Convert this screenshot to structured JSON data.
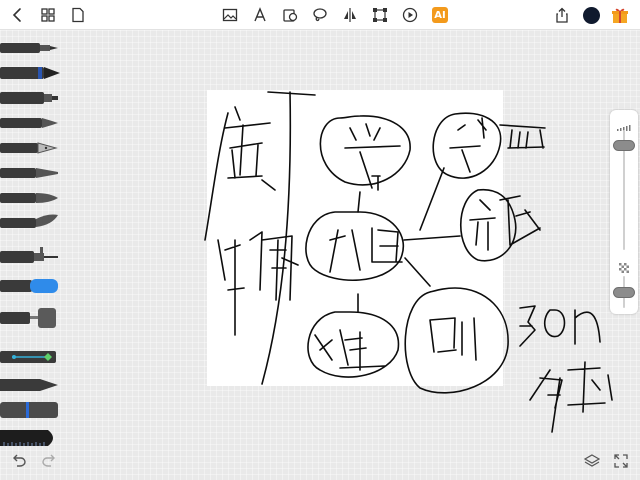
{
  "toolbar": {
    "ai_label": "AI",
    "left_icons": [
      "back-icon",
      "grid-icon",
      "document-icon"
    ],
    "center_icons": [
      "image-icon",
      "text-icon",
      "shape-icon",
      "lasso-icon",
      "flip-icon",
      "transform-icon",
      "play-icon",
      "ai-icon"
    ],
    "right_icons": [
      "share-icon",
      "color-swatch",
      "gift-icon"
    ],
    "current_color": "#101a2e",
    "ai_color": "#f39a1c"
  },
  "brushes": [
    "pencil",
    "technical-pen",
    "marker",
    "fineliner",
    "fountain-pen",
    "calligraphy-pen",
    "brush",
    "flat-brush",
    "airbrush",
    "eraser",
    "paint-roller",
    "blend-tool",
    "smudge",
    "ruler-pen",
    "ruler"
  ],
  "sliders": {
    "size_level": 0.18,
    "opacity_level": 1.0
  },
  "footer": {
    "left_icons": [
      "undo-icon",
      "redo-icon"
    ],
    "right_icons": [
      "layers-icon",
      "fullscreen-icon"
    ]
  }
}
